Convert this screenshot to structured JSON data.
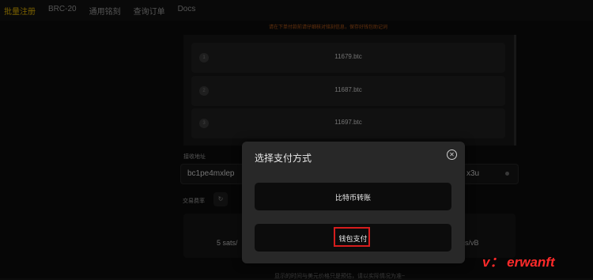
{
  "nav": {
    "items": [
      {
        "label": "批量注册"
      },
      {
        "label": "BRC-20"
      },
      {
        "label": "通用铭刻"
      },
      {
        "label": "查询订单"
      },
      {
        "label": "Docs"
      }
    ]
  },
  "warning": "请在下单付款前请仔细核对铭刻信息，保存好钱包助记词",
  "list": {
    "rows": [
      {
        "index": "1",
        "name": "11679.btc"
      },
      {
        "index": "2",
        "name": "11687.btc"
      },
      {
        "index": "3",
        "name": "11697.btc"
      }
    ]
  },
  "receive": {
    "label": "接收地址",
    "value_start": "bc1pe4mxlep",
    "value_end": "x3u"
  },
  "fee": {
    "label": "交易费率",
    "left_value": "5 sats/",
    "right_value": "s/vB"
  },
  "footnote": "显示的时间与美元价格只是预估，请以实际情况为准~",
  "modal": {
    "title": "选择支付方式",
    "option1": "比特币转账",
    "option2": "钱包支付"
  },
  "watermark": "v： erwanft",
  "colors": {
    "accent": "#e0b100",
    "highlight": "#d61d1d",
    "watermark": "#ff2a2a"
  }
}
